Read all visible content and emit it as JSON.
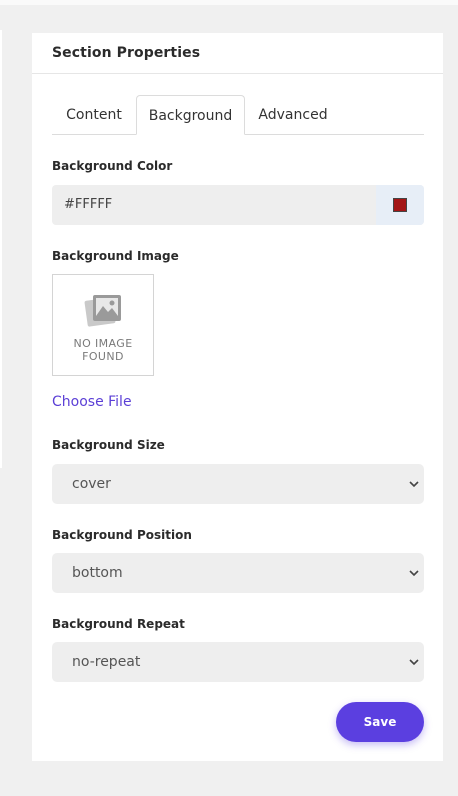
{
  "panel": {
    "title": "Section Properties"
  },
  "tabs": [
    {
      "label": "Content",
      "active": false
    },
    {
      "label": "Background",
      "active": true
    },
    {
      "label": "Advanced",
      "active": false
    }
  ],
  "background_color": {
    "label": "Background Color",
    "value": "#FFFFF",
    "swatch_color": "#a31515"
  },
  "background_image": {
    "label": "Background Image",
    "placeholder_line1": "NO IMAGE",
    "placeholder_line2": "FOUND",
    "choose_file": "Choose File"
  },
  "background_size": {
    "label": "Background Size",
    "selected": "cover"
  },
  "background_position": {
    "label": "Background Position",
    "selected": "bottom"
  },
  "background_repeat": {
    "label": "Background Repeat",
    "selected": "no-repeat"
  },
  "actions": {
    "save_label": "Save"
  },
  "colors": {
    "accent": "#5b3fe0",
    "link": "#5b3fd6"
  }
}
